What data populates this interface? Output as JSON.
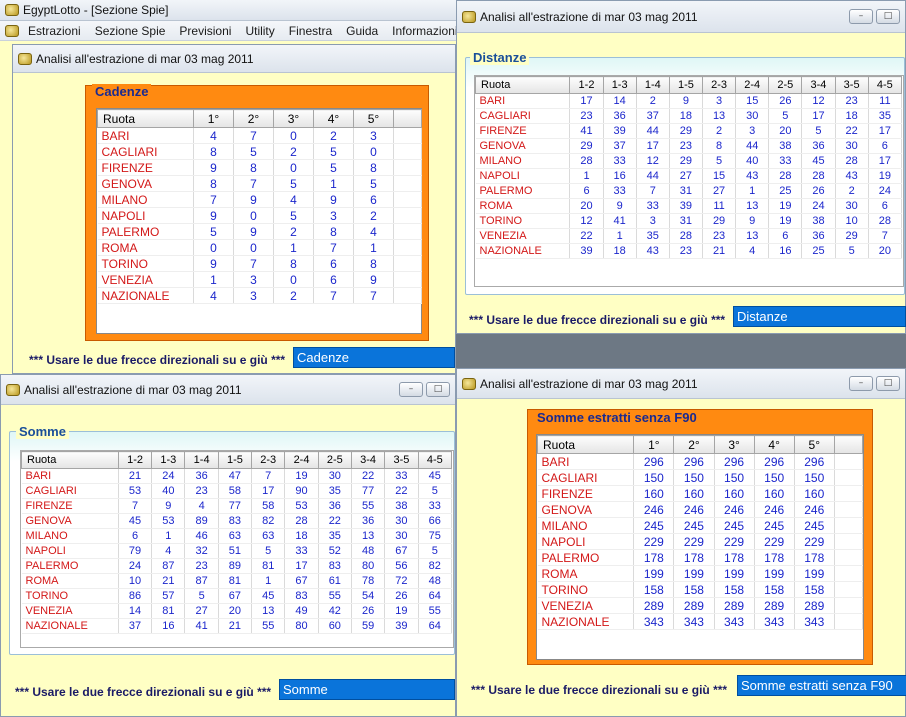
{
  "app": {
    "title": "EgyptLotto - [Sezione Spie]"
  },
  "menu": [
    "Estrazioni",
    "Sezione Spie",
    "Previsioni",
    "Utility",
    "Finestra",
    "Guida",
    "Informazioni"
  ],
  "windows": {
    "cadenze": {
      "title": "Analisi all'estrazione di mar 03 mag 2011",
      "legend": "Cadenze",
      "instruction": "*** Usare le due frecce direzionali su e giù ***",
      "combo": "Cadenze"
    },
    "distanze": {
      "title": "Analisi all'estrazione di mar 03 mag 2011",
      "legend": "Distanze",
      "instruction": "*** Usare le due frecce direzionali su e giù ***",
      "combo": "Distanze"
    },
    "somme": {
      "title": "Analisi all'estrazione di mar 03 mag 2011",
      "legend": "Somme",
      "instruction": "*** Usare le due frecce direzionali su e giù ***",
      "combo": "Somme"
    },
    "sommeF90": {
      "title": "Analisi all'estrazione di mar 03 mag 2011",
      "legend": "Somme estratti senza F90",
      "instruction": "*** Usare le due frecce direzionali su e giù ***",
      "combo": "Somme estratti senza F90"
    }
  },
  "ruote": [
    "BARI",
    "CAGLIARI",
    "FIRENZE",
    "GENOVA",
    "MILANO",
    "NAPOLI",
    "PALERMO",
    "ROMA",
    "TORINO",
    "VENEZIA",
    "NAZIONALE"
  ],
  "headers_pos": [
    "Ruota",
    "1°",
    "2°",
    "3°",
    "4°",
    "5°"
  ],
  "headers_pairs": [
    "Ruota",
    "1-2",
    "1-3",
    "1-4",
    "1-5",
    "2-3",
    "2-4",
    "2-5",
    "3-4",
    "3-5",
    "4-5"
  ],
  "cadenze_rows": [
    [
      4,
      7,
      0,
      2,
      3
    ],
    [
      8,
      5,
      2,
      5,
      0
    ],
    [
      9,
      8,
      0,
      5,
      8
    ],
    [
      8,
      7,
      5,
      1,
      5
    ],
    [
      7,
      9,
      4,
      9,
      6
    ],
    [
      9,
      0,
      5,
      3,
      2
    ],
    [
      5,
      9,
      2,
      8,
      4
    ],
    [
      0,
      0,
      1,
      7,
      1
    ],
    [
      9,
      7,
      8,
      6,
      8
    ],
    [
      1,
      3,
      0,
      6,
      9
    ],
    [
      4,
      3,
      2,
      7,
      7
    ]
  ],
  "distanze_rows": [
    [
      17,
      14,
      2,
      9,
      3,
      15,
      26,
      12,
      23,
      11
    ],
    [
      23,
      36,
      37,
      18,
      13,
      30,
      5,
      17,
      18,
      35
    ],
    [
      41,
      39,
      44,
      29,
      2,
      3,
      20,
      5,
      22,
      17
    ],
    [
      29,
      37,
      17,
      23,
      8,
      44,
      38,
      36,
      30,
      6
    ],
    [
      28,
      33,
      12,
      29,
      5,
      40,
      33,
      45,
      28,
      17
    ],
    [
      1,
      16,
      44,
      27,
      15,
      43,
      28,
      28,
      43,
      19
    ],
    [
      6,
      33,
      7,
      31,
      27,
      1,
      25,
      26,
      2,
      24
    ],
    [
      20,
      9,
      33,
      39,
      11,
      13,
      19,
      24,
      30,
      6
    ],
    [
      12,
      41,
      3,
      31,
      29,
      9,
      19,
      38,
      10,
      28
    ],
    [
      22,
      1,
      35,
      28,
      23,
      13,
      6,
      36,
      29,
      7
    ],
    [
      39,
      18,
      43,
      23,
      21,
      4,
      16,
      25,
      5,
      20
    ]
  ],
  "somme_rows": [
    [
      21,
      24,
      36,
      47,
      7,
      19,
      30,
      22,
      33,
      45
    ],
    [
      53,
      40,
      23,
      58,
      17,
      90,
      35,
      77,
      22,
      5
    ],
    [
      7,
      9,
      4,
      77,
      58,
      53,
      36,
      55,
      38,
      33
    ],
    [
      45,
      53,
      89,
      83,
      82,
      28,
      22,
      36,
      30,
      66
    ],
    [
      6,
      1,
      46,
      63,
      63,
      18,
      35,
      13,
      30,
      75
    ],
    [
      79,
      4,
      32,
      51,
      5,
      33,
      52,
      48,
      67,
      5
    ],
    [
      24,
      87,
      23,
      89,
      81,
      17,
      83,
      80,
      56,
      82
    ],
    [
      10,
      21,
      87,
      81,
      1,
      67,
      61,
      78,
      72,
      48
    ],
    [
      86,
      57,
      5,
      67,
      45,
      83,
      55,
      54,
      26,
      64
    ],
    [
      14,
      81,
      27,
      20,
      13,
      49,
      42,
      26,
      19,
      55
    ],
    [
      37,
      16,
      41,
      21,
      55,
      80,
      60,
      59,
      39,
      64
    ]
  ],
  "sommeF90_rows": [
    [
      296,
      296,
      296,
      296,
      296
    ],
    [
      150,
      150,
      150,
      150,
      150
    ],
    [
      160,
      160,
      160,
      160,
      160
    ],
    [
      246,
      246,
      246,
      246,
      246
    ],
    [
      245,
      245,
      245,
      245,
      245
    ],
    [
      229,
      229,
      229,
      229,
      229
    ],
    [
      178,
      178,
      178,
      178,
      178
    ],
    [
      199,
      199,
      199,
      199,
      199
    ],
    [
      158,
      158,
      158,
      158,
      158
    ],
    [
      289,
      289,
      289,
      289,
      289
    ],
    [
      343,
      343,
      343,
      343,
      343
    ]
  ]
}
